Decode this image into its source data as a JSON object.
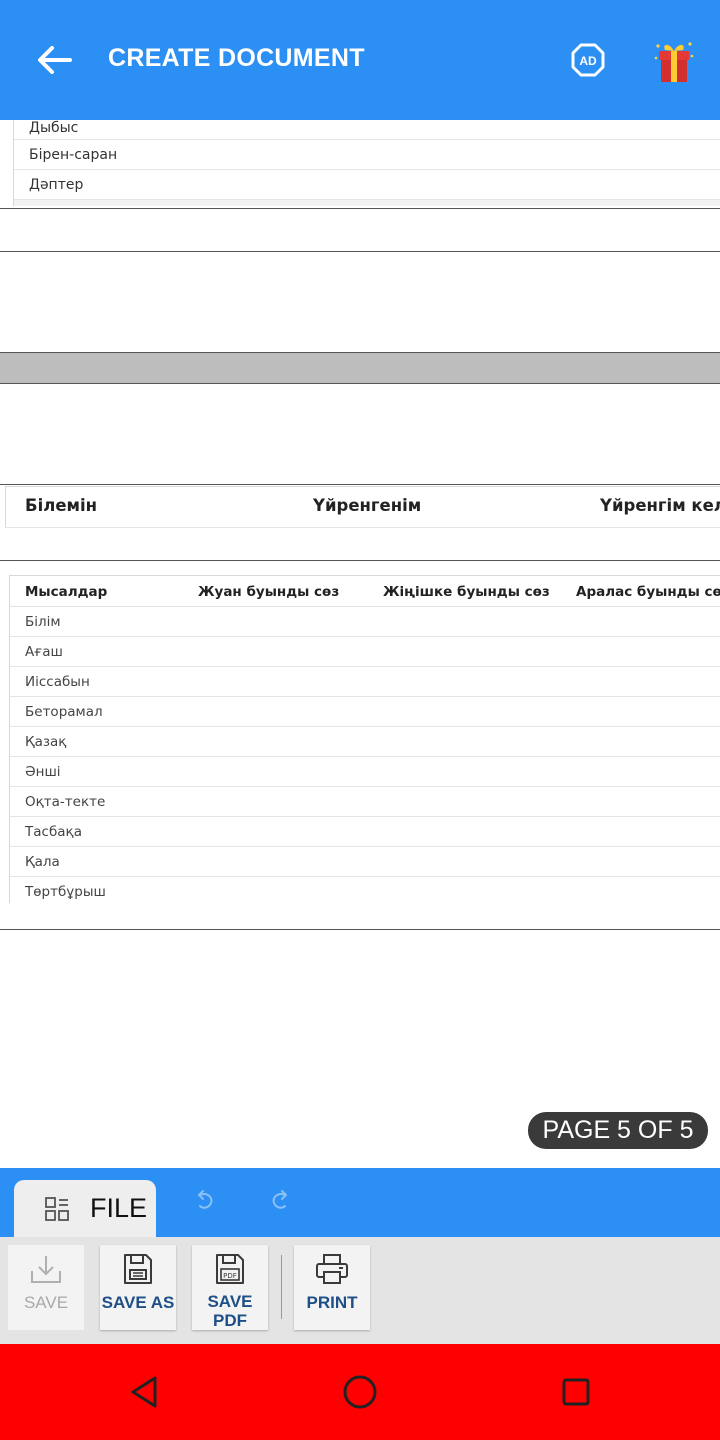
{
  "header": {
    "title": "CREATE DOCUMENT",
    "back_icon": "arrow-left-icon",
    "ad_icon": "remove-ads-icon",
    "ad_label": "AD",
    "gift_icon": "gift-icon"
  },
  "document": {
    "top_table_rows": [
      "Дыбыс",
      "Бірен-саран",
      "Дәптер"
    ],
    "know_table_headers": [
      "Білемін",
      "Үйренгенім",
      "Үйренгім келе"
    ],
    "examples_table": {
      "headers": [
        "Мысалдар",
        "Жуан буынды сөз",
        "Жіңішке буынды сөз",
        "Аралас буынды сөз"
      ],
      "rows": [
        "Білім",
        "Ағаш",
        "Иіссабын",
        "Бетoрамал",
        "Қазақ",
        "Әнші",
        "Оқта-текте",
        "Тасбақа",
        "Қала",
        "Төртбұрыш"
      ]
    },
    "page_indicator": "PAGE 5 OF 5"
  },
  "ribbon": {
    "file_tab_label": "FILE",
    "file_tab_icon": "grid-list-icon",
    "undo_icon": "undo-icon",
    "redo_icon": "redo-icon",
    "tools": [
      {
        "label": "SAVE",
        "icon": "download-save-icon",
        "enabled": false
      },
      {
        "label": "SAVE AS",
        "icon": "floppy-disk-icon",
        "enabled": true
      },
      {
        "label": "SAVE PDF",
        "icon": "floppy-pdf-icon",
        "enabled": true
      },
      {
        "label": "PRINT",
        "icon": "printer-icon",
        "enabled": true
      }
    ]
  },
  "navigation": {
    "back_icon": "nav-back-triangle-icon",
    "home_icon": "nav-home-circle-icon",
    "recents_icon": "nav-recents-square-icon"
  },
  "colors": {
    "appbar": "#2b8ff4",
    "navbar": "#ff0000",
    "tool_label": "#1e4f86",
    "page_badge": "#3a3a3a"
  }
}
